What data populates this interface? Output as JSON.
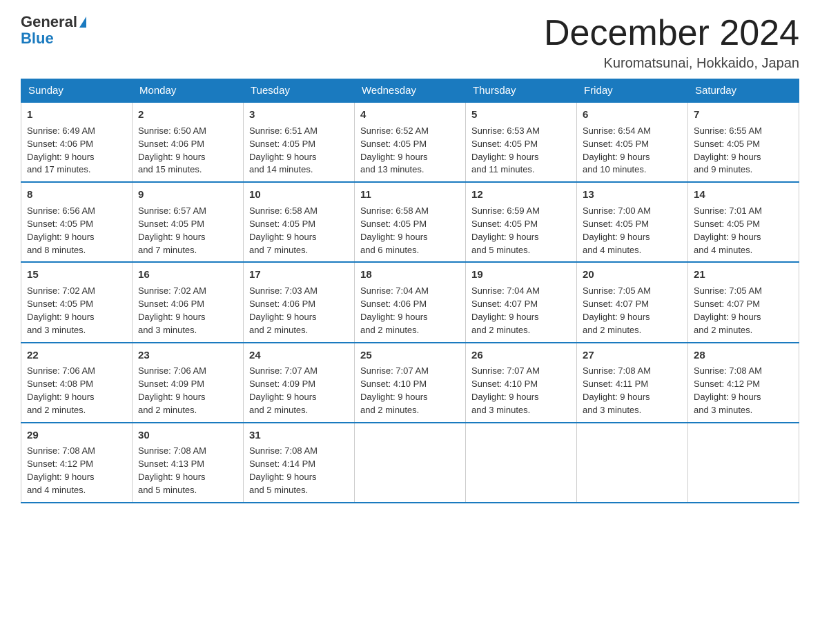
{
  "header": {
    "logo_line1": "General",
    "logo_line2": "Blue",
    "month_title": "December 2024",
    "location": "Kuromatsunai, Hokkaido, Japan"
  },
  "weekdays": [
    "Sunday",
    "Monday",
    "Tuesday",
    "Wednesday",
    "Thursday",
    "Friday",
    "Saturday"
  ],
  "weeks": [
    [
      {
        "day": "1",
        "sunrise": "6:49 AM",
        "sunset": "4:06 PM",
        "daylight": "9 hours and 17 minutes."
      },
      {
        "day": "2",
        "sunrise": "6:50 AM",
        "sunset": "4:06 PM",
        "daylight": "9 hours and 15 minutes."
      },
      {
        "day": "3",
        "sunrise": "6:51 AM",
        "sunset": "4:05 PM",
        "daylight": "9 hours and 14 minutes."
      },
      {
        "day": "4",
        "sunrise": "6:52 AM",
        "sunset": "4:05 PM",
        "daylight": "9 hours and 13 minutes."
      },
      {
        "day": "5",
        "sunrise": "6:53 AM",
        "sunset": "4:05 PM",
        "daylight": "9 hours and 11 minutes."
      },
      {
        "day": "6",
        "sunrise": "6:54 AM",
        "sunset": "4:05 PM",
        "daylight": "9 hours and 10 minutes."
      },
      {
        "day": "7",
        "sunrise": "6:55 AM",
        "sunset": "4:05 PM",
        "daylight": "9 hours and 9 minutes."
      }
    ],
    [
      {
        "day": "8",
        "sunrise": "6:56 AM",
        "sunset": "4:05 PM",
        "daylight": "9 hours and 8 minutes."
      },
      {
        "day": "9",
        "sunrise": "6:57 AM",
        "sunset": "4:05 PM",
        "daylight": "9 hours and 7 minutes."
      },
      {
        "day": "10",
        "sunrise": "6:58 AM",
        "sunset": "4:05 PM",
        "daylight": "9 hours and 7 minutes."
      },
      {
        "day": "11",
        "sunrise": "6:58 AM",
        "sunset": "4:05 PM",
        "daylight": "9 hours and 6 minutes."
      },
      {
        "day": "12",
        "sunrise": "6:59 AM",
        "sunset": "4:05 PM",
        "daylight": "9 hours and 5 minutes."
      },
      {
        "day": "13",
        "sunrise": "7:00 AM",
        "sunset": "4:05 PM",
        "daylight": "9 hours and 4 minutes."
      },
      {
        "day": "14",
        "sunrise": "7:01 AM",
        "sunset": "4:05 PM",
        "daylight": "9 hours and 4 minutes."
      }
    ],
    [
      {
        "day": "15",
        "sunrise": "7:02 AM",
        "sunset": "4:05 PM",
        "daylight": "9 hours and 3 minutes."
      },
      {
        "day": "16",
        "sunrise": "7:02 AM",
        "sunset": "4:06 PM",
        "daylight": "9 hours and 3 minutes."
      },
      {
        "day": "17",
        "sunrise": "7:03 AM",
        "sunset": "4:06 PM",
        "daylight": "9 hours and 2 minutes."
      },
      {
        "day": "18",
        "sunrise": "7:04 AM",
        "sunset": "4:06 PM",
        "daylight": "9 hours and 2 minutes."
      },
      {
        "day": "19",
        "sunrise": "7:04 AM",
        "sunset": "4:07 PM",
        "daylight": "9 hours and 2 minutes."
      },
      {
        "day": "20",
        "sunrise": "7:05 AM",
        "sunset": "4:07 PM",
        "daylight": "9 hours and 2 minutes."
      },
      {
        "day": "21",
        "sunrise": "7:05 AM",
        "sunset": "4:07 PM",
        "daylight": "9 hours and 2 minutes."
      }
    ],
    [
      {
        "day": "22",
        "sunrise": "7:06 AM",
        "sunset": "4:08 PM",
        "daylight": "9 hours and 2 minutes."
      },
      {
        "day": "23",
        "sunrise": "7:06 AM",
        "sunset": "4:09 PM",
        "daylight": "9 hours and 2 minutes."
      },
      {
        "day": "24",
        "sunrise": "7:07 AM",
        "sunset": "4:09 PM",
        "daylight": "9 hours and 2 minutes."
      },
      {
        "day": "25",
        "sunrise": "7:07 AM",
        "sunset": "4:10 PM",
        "daylight": "9 hours and 2 minutes."
      },
      {
        "day": "26",
        "sunrise": "7:07 AM",
        "sunset": "4:10 PM",
        "daylight": "9 hours and 3 minutes."
      },
      {
        "day": "27",
        "sunrise": "7:08 AM",
        "sunset": "4:11 PM",
        "daylight": "9 hours and 3 minutes."
      },
      {
        "day": "28",
        "sunrise": "7:08 AM",
        "sunset": "4:12 PM",
        "daylight": "9 hours and 3 minutes."
      }
    ],
    [
      {
        "day": "29",
        "sunrise": "7:08 AM",
        "sunset": "4:12 PM",
        "daylight": "9 hours and 4 minutes."
      },
      {
        "day": "30",
        "sunrise": "7:08 AM",
        "sunset": "4:13 PM",
        "daylight": "9 hours and 5 minutes."
      },
      {
        "day": "31",
        "sunrise": "7:08 AM",
        "sunset": "4:14 PM",
        "daylight": "9 hours and 5 minutes."
      },
      null,
      null,
      null,
      null
    ]
  ],
  "labels": {
    "sunrise": "Sunrise:",
    "sunset": "Sunset:",
    "daylight": "Daylight:"
  }
}
